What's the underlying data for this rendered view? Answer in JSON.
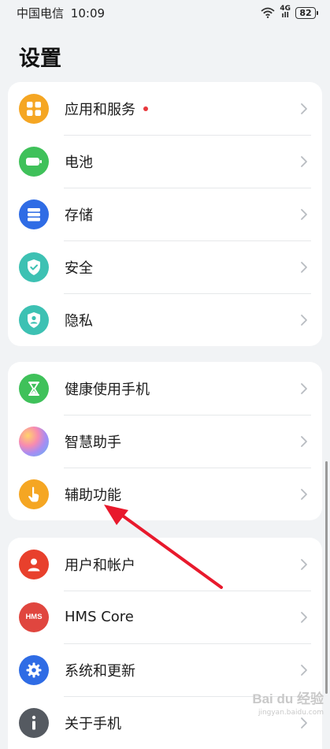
{
  "status_bar": {
    "carrier": "中国电信",
    "time": "10:09",
    "network": "4G",
    "network_bars": "ıll",
    "battery": "82"
  },
  "page_title": "设置",
  "groups": [
    {
      "items": [
        {
          "label": "应用和服务",
          "icon": "apps-grid-icon",
          "color": "#f5a623",
          "badge_dot": true
        },
        {
          "label": "电池",
          "icon": "battery-icon",
          "color": "#3fc15a",
          "badge_dot": false
        },
        {
          "label": "存储",
          "icon": "storage-icon",
          "color": "#2f6ce5",
          "badge_dot": false
        },
        {
          "label": "安全",
          "icon": "shield-check-icon",
          "color": "#3dc1b3",
          "badge_dot": false
        },
        {
          "label": "隐私",
          "icon": "privacy-shield-icon",
          "color": "#3dc1b3",
          "badge_dot": false
        }
      ]
    },
    {
      "items": [
        {
          "label": "健康使用手机",
          "icon": "hourglass-icon",
          "color": "#3fc15a",
          "badge_dot": false
        },
        {
          "label": "智慧助手",
          "icon": "assistant-orb-icon",
          "color": "#b98cf0",
          "badge_dot": false
        },
        {
          "label": "辅助功能",
          "icon": "hand-pointer-icon",
          "color": "#f5a623",
          "badge_dot": false
        }
      ]
    },
    {
      "items": [
        {
          "label": "用户和帐户",
          "icon": "user-icon",
          "color": "#e8402c",
          "badge_dot": false
        },
        {
          "label": "HMS Core",
          "icon": "hms-icon",
          "color": "#e0463f",
          "badge_dot": false
        },
        {
          "label": "系统和更新",
          "icon": "gear-icon",
          "color": "#2f6ce5",
          "badge_dot": false
        },
        {
          "label": "关于手机",
          "icon": "info-icon",
          "color": "#555a61",
          "badge_dot": false
        }
      ]
    }
  ],
  "hms_icon_text": "HMS",
  "watermark": {
    "main": "Bai du 经验",
    "sub": "jingyan.baidu.com"
  },
  "colors": {
    "background": "#f1f3f5",
    "card": "#ffffff",
    "arrow": "#e8192c",
    "badge": "#e8383d"
  }
}
